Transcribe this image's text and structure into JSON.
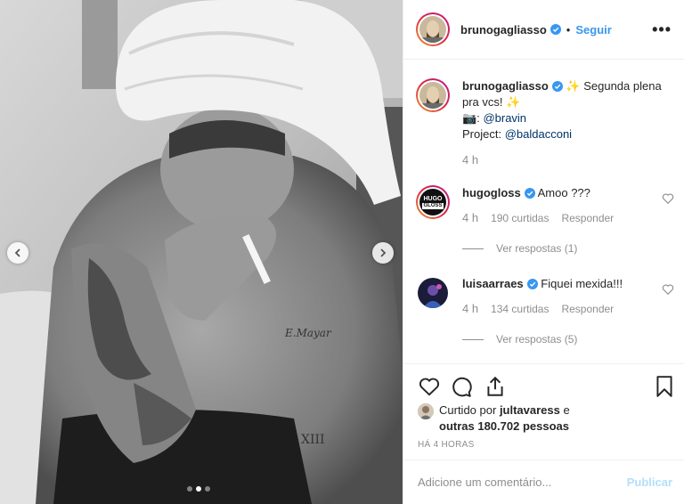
{
  "post": {
    "author": "brunogagliasso",
    "separator": "•",
    "follow_label": "Seguir",
    "more_label": "•••",
    "image_description_icon": "photo-icon",
    "carousel": {
      "dots": 3,
      "active_index": 1
    }
  },
  "caption": {
    "username": "brunogagliasso",
    "text_line1": "✨ Segunda plena pra vcs! ✨",
    "camera_emoji": "📷:",
    "photo_credit": "@bravin",
    "project_label": "Project:",
    "project_credit": "@baldacconi",
    "time": "4 h"
  },
  "comments": [
    {
      "username": "hugogloss",
      "avatar_text_top": "HUGO",
      "avatar_text_bottom": "GLOSS",
      "text": "Amoo ???",
      "time": "4 h",
      "likes": "190 curtidas",
      "reply_label": "Responder",
      "view_replies": "Ver respostas (1)"
    },
    {
      "username": "luisaarraes",
      "text": "Fiquei mexida!!!",
      "time": "4 h",
      "likes": "134 curtidas",
      "reply_label": "Responder",
      "view_replies": "Ver respostas (5)"
    }
  ],
  "likes": {
    "prefix": "Curtido por",
    "first_user": "jultavaress",
    "connector": "e",
    "others": "outras 180.702 pessoas"
  },
  "timestamp": "HÁ 4 HORAS",
  "add_comment": {
    "placeholder": "Adicione um comentário...",
    "publish_label": "Publicar"
  },
  "colors": {
    "link": "#3897f0",
    "verified": "#3897f0",
    "muted": "#8e8e8e",
    "publish_disabled": "#b2dffc"
  }
}
